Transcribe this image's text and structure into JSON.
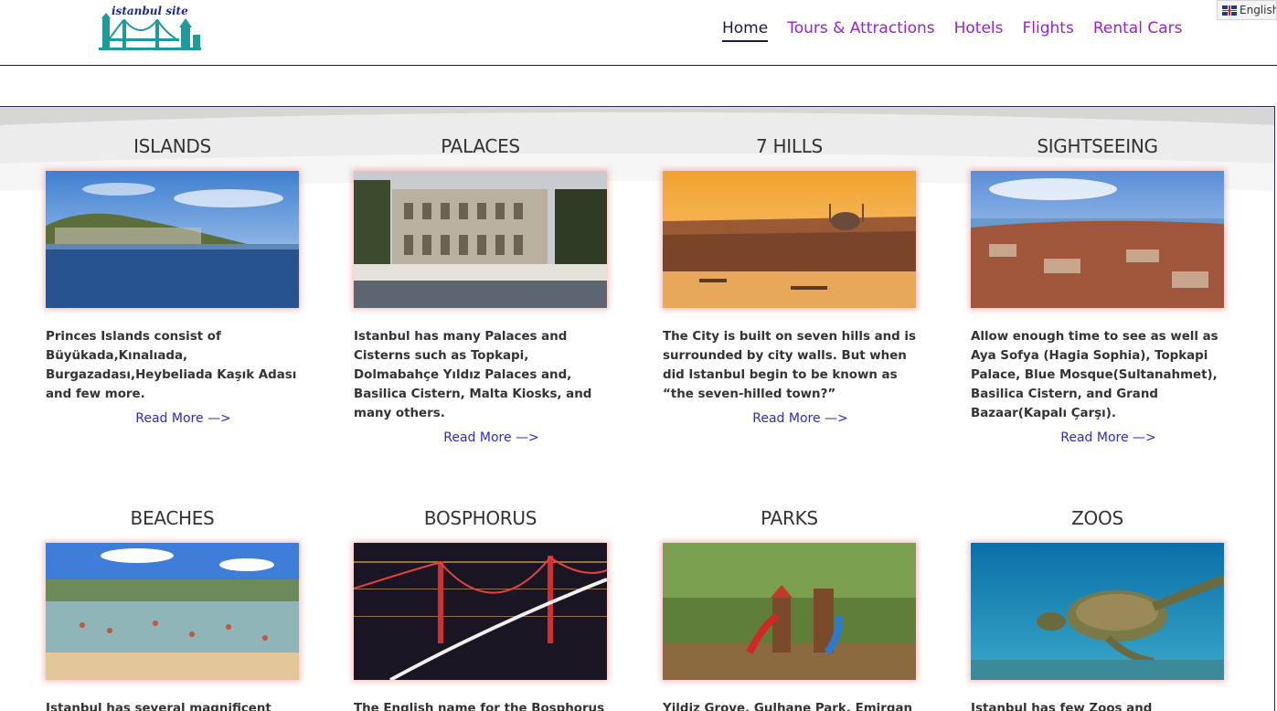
{
  "site": {
    "logo_text": "istanbul site"
  },
  "nav": {
    "items": [
      {
        "label": "Home",
        "active": true
      },
      {
        "label": "Tours & Attractions",
        "active": false
      },
      {
        "label": "Hotels",
        "active": false
      },
      {
        "label": "Flights",
        "active": false
      },
      {
        "label": "Rental Cars",
        "active": false
      }
    ]
  },
  "language": {
    "selected": "English",
    "flag_icon": "uk-flag-icon"
  },
  "colors": {
    "nav_link": "#9b1fd6",
    "nav_active": "#1a1a40",
    "read_more": "#2b2bd0",
    "card_text": "#333333"
  },
  "cards": [
    {
      "title": "ISLANDS",
      "text": "Princes Islands consist of Büyükada,Kınalıada, Burgazadası,Heybeliada Kaşık Adası and few more.",
      "link": "Read More —>",
      "photo": "islands-photo"
    },
    {
      "title": "PALACES",
      "text": "Istanbul has many Palaces and Cisterns such as Topkapi, Dolmabahçe Yıldız Palaces and, Basilica Cistern, Malta Kiosks, and many others.",
      "link": "Read More —>",
      "photo": "palace-photo"
    },
    {
      "title": "7 HILLS",
      "text": "The City is built on seven hills and is surrounded by city walls. But when did Istanbul begin to be known as “the seven-hilled town?”",
      "link": "Read More —>",
      "photo": "hills-photo"
    },
    {
      "title": "SIGHTSEEING",
      "text": "Allow enough time to see as well as Aya Sofya (Hagia Sophia), Topkapi Palace, Blue Mosque(Sultanahmet), Basilica Cistern, and Grand Bazaar(Kapalı Çarşı).",
      "link": "Read More —>",
      "photo": "sightseeing-photo"
    },
    {
      "title": "BEACHES",
      "text": "Istanbul has several magnificent",
      "link": "",
      "photo": "beach-photo"
    },
    {
      "title": "BOSPHORUS",
      "text": "The English name for the Bosphorus",
      "link": "",
      "photo": "bosphorus-photo"
    },
    {
      "title": "PARKS",
      "text": "Yildiz Grove, Gulhane Park, Emirgan",
      "link": "",
      "photo": "park-photo"
    },
    {
      "title": "ZOOS",
      "text": "Istanbul has few Zoos and Aquariums",
      "link": "",
      "photo": "turtle-photo"
    }
  ]
}
